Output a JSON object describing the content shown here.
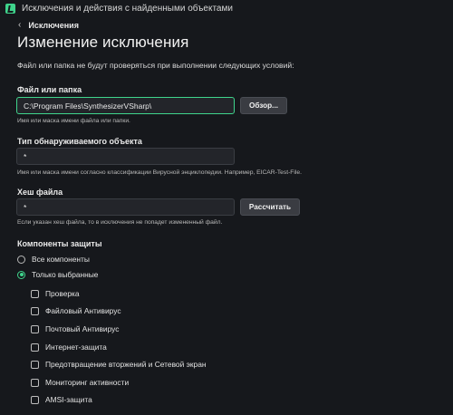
{
  "window": {
    "title": "Исключения и действия с найденными объектами"
  },
  "nav": {
    "back_label": "Исключения"
  },
  "page": {
    "title": "Изменение исключения",
    "description": "Файл или папка не будут проверяться при выполнении следующих условий:"
  },
  "file_field": {
    "label": "Файл или папка",
    "value": "C:\\Program Files\\SynthesizerVSharp\\",
    "browse_label": "Обзор...",
    "hint": "Имя или маска имени файла или папки."
  },
  "object_type_field": {
    "label": "Тип обнаруживаемого объекта",
    "value": "*",
    "hint": "Имя или маска имени согласно классификации Вирусной энциклопедии. Например, EICAR-Test-File."
  },
  "hash_field": {
    "label": "Хеш файла",
    "value": "*",
    "calculate_label": "Рассчитать",
    "hint": "Если указан хеш файла, то в исключения не попадет измененный файл."
  },
  "components": {
    "title": "Компоненты защиты",
    "options": [
      {
        "label": "Все компоненты",
        "selected": false
      },
      {
        "label": "Только выбранные",
        "selected": true
      }
    ],
    "items": [
      {
        "label": "Проверка",
        "checked": false
      },
      {
        "label": "Файловый Антивирус",
        "checked": false
      },
      {
        "label": "Почтовый Антивирус",
        "checked": false
      },
      {
        "label": "Интернет-защита",
        "checked": false
      },
      {
        "label": "Предотвращение вторжений и Сетевой экран",
        "checked": false
      },
      {
        "label": "Мониторинг активности",
        "checked": false
      },
      {
        "label": "AMSI-защита",
        "checked": false
      }
    ]
  },
  "colors": {
    "background": "#16181c",
    "accent": "#3fd48c",
    "input_bg": "#23252a",
    "button_bg": "#3a3c42"
  }
}
